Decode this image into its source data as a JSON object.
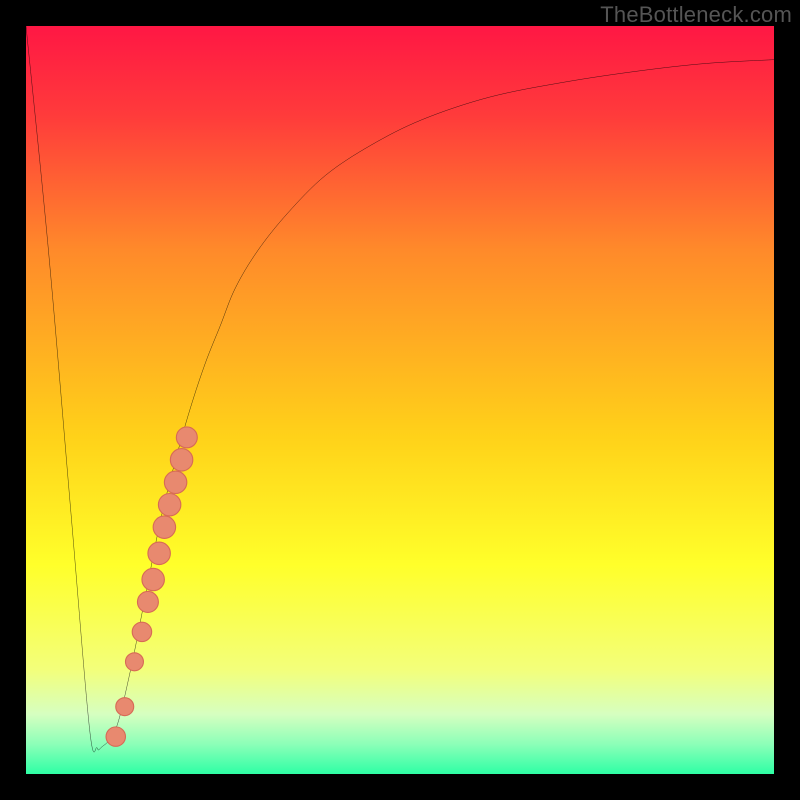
{
  "watermark": {
    "text": "TheBottleneck.com"
  },
  "colors": {
    "frame": "#000000",
    "curve": "#000000",
    "marker_fill": "#e8896f",
    "marker_stroke": "#d76a56",
    "gradient_stops": [
      {
        "pct": 0,
        "color": "#ff1744"
      },
      {
        "pct": 12,
        "color": "#ff3b3b"
      },
      {
        "pct": 30,
        "color": "#ff8a2a"
      },
      {
        "pct": 55,
        "color": "#ffd219"
      },
      {
        "pct": 72,
        "color": "#ffff2a"
      },
      {
        "pct": 86,
        "color": "#f3ff7a"
      },
      {
        "pct": 92,
        "color": "#d6ffc0"
      },
      {
        "pct": 96,
        "color": "#8cffb8"
      },
      {
        "pct": 100,
        "color": "#2effa5"
      }
    ]
  },
  "chart_data": {
    "type": "line",
    "title": "",
    "xlabel": "",
    "ylabel": "",
    "xlim": [
      0,
      100
    ],
    "ylim": [
      0,
      100
    ],
    "series": [
      {
        "name": "bottleneck-curve",
        "x": [
          0,
          3,
          6,
          8.5,
          9.5,
          10,
          12,
          14,
          16,
          18,
          20,
          22,
          24,
          26,
          28,
          31,
          35,
          40,
          46,
          53,
          62,
          72,
          82,
          91,
          100
        ],
        "y": [
          100,
          70,
          35,
          6,
          3.5,
          3.5,
          6,
          14,
          24,
          34,
          42,
          49,
          55,
          60,
          65,
          70,
          75,
          80,
          84,
          87.5,
          90.5,
          92.5,
          94,
          95,
          95.5
        ]
      }
    ],
    "markers": [
      {
        "x": 12.0,
        "y": 5.0,
        "r": 1.3
      },
      {
        "x": 13.2,
        "y": 9.0,
        "r": 1.2
      },
      {
        "x": 14.5,
        "y": 15.0,
        "r": 1.2
      },
      {
        "x": 15.5,
        "y": 19.0,
        "r": 1.3
      },
      {
        "x": 16.3,
        "y": 23.0,
        "r": 1.4
      },
      {
        "x": 17.0,
        "y": 26.0,
        "r": 1.5
      },
      {
        "x": 17.8,
        "y": 29.5,
        "r": 1.5
      },
      {
        "x": 18.5,
        "y": 33.0,
        "r": 1.5
      },
      {
        "x": 19.2,
        "y": 36.0,
        "r": 1.5
      },
      {
        "x": 20.0,
        "y": 39.0,
        "r": 1.5
      },
      {
        "x": 20.8,
        "y": 42.0,
        "r": 1.5
      },
      {
        "x": 21.5,
        "y": 45.0,
        "r": 1.4
      }
    ]
  }
}
